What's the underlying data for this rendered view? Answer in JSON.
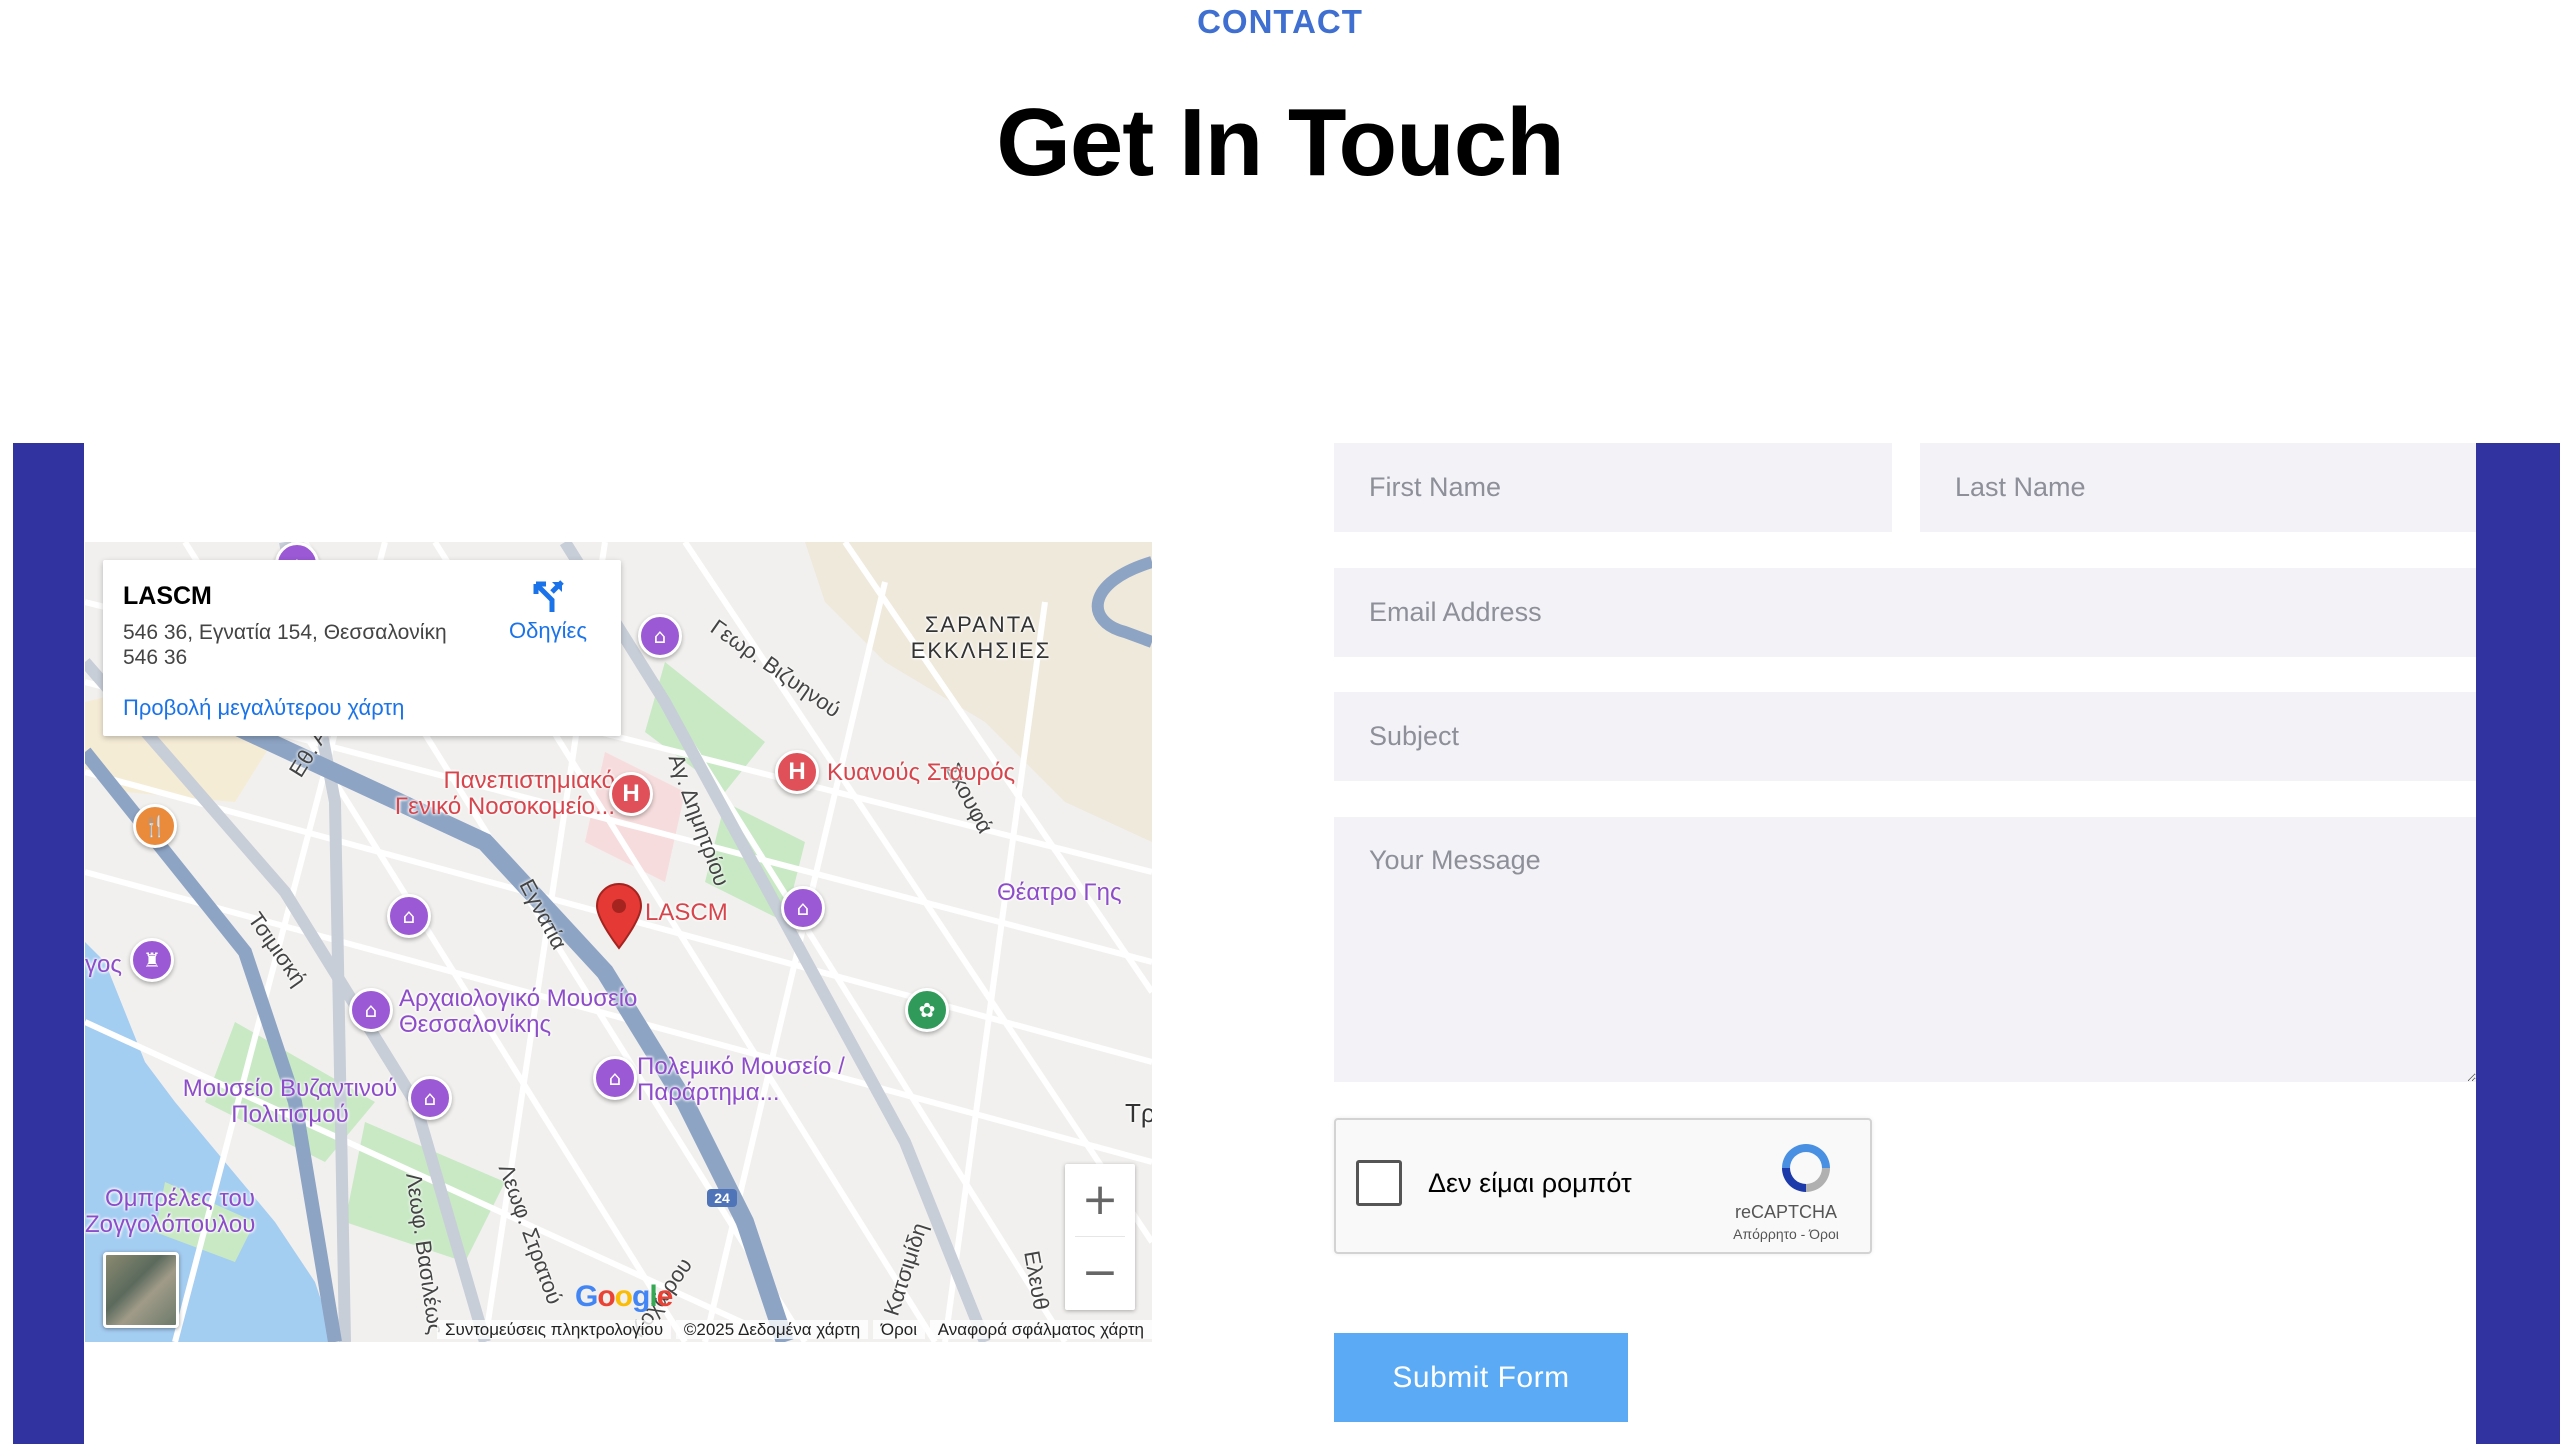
{
  "header": {
    "eyebrow": "CONTACT",
    "title": "Get In Touch"
  },
  "map": {
    "info_card": {
      "name": "LASCM",
      "address": "546 36, Εγνατία 154, Θεσσαλονίκη 546 36",
      "directions_label": "Οδηγίες",
      "larger_map_link": "Προβολή μεγαλύτερου χάρτη"
    },
    "marker_label": "LASCM",
    "places": {
      "hospital_1": "Πανεπιστημιακό Γενικό Νοσοκομείο...",
      "hospital_2": "Κυανούς Σταυρός",
      "district": "ΣΑΡΑΝΤΑ ΕΚΚΛΗΣΙΕΣ",
      "theatre": "Θέατρο Γης",
      "museum_archaeological": "Αρχαιολογικό Μουσείο Θεσσαλονίκης",
      "museum_byzantine": "Μουσείο Βυζαντινού Πολιτισμού",
      "museum_war": "Πολεμικό Μουσείο / Παράρτημα...",
      "umbrellas": "Ομπρέλες του Ζογγολόπουλου",
      "partial_left": "γος",
      "partial_right": "Τρ"
    },
    "streets": {
      "egnatia": "Εγνατία",
      "ethn_aminis": "Εθ. Αμύνης",
      "tsimiski": "Τσιμισκή",
      "ag_dimitriou": "Αγ. Δημητρίου",
      "georg_vizyinou": "Γεωρ. Βιζυηνού",
      "skoufa": "Σκουφά",
      "leof_vasileos": "Λεωφ. Βασιλέως",
      "leof_stratou": "Λεωφ. Στρατού",
      "katsimidi": "Κατσιμίδη",
      "kochorou": "Κοχώρου",
      "elevtheriou": "Ελευθ"
    },
    "route_shield": "24",
    "zoom_in": "+",
    "zoom_out": "−",
    "google_logo": "Google",
    "attribution": {
      "shortcuts": "Συντομεύσεις πληκτρολογίου",
      "data": "©2025 Δεδομένα χάρτη",
      "terms": "Όροι",
      "report": "Αναφορά σφάλματος χάρτη"
    }
  },
  "form": {
    "first_name_placeholder": "First Name",
    "last_name_placeholder": "Last Name",
    "email_placeholder": "Email Address",
    "subject_placeholder": "Subject",
    "message_placeholder": "Your Message",
    "captcha": {
      "label": "Δεν είμαι ρομπότ",
      "brand": "reCAPTCHA",
      "terms": "Απόρρητο - Όροι"
    },
    "submit_label": "Submit Form"
  },
  "colors": {
    "accent_blue": "#3e6fd1",
    "side_bar": "#3033a0",
    "submit_button": "#5aaaf5",
    "field_background": "#f3f3f7"
  }
}
